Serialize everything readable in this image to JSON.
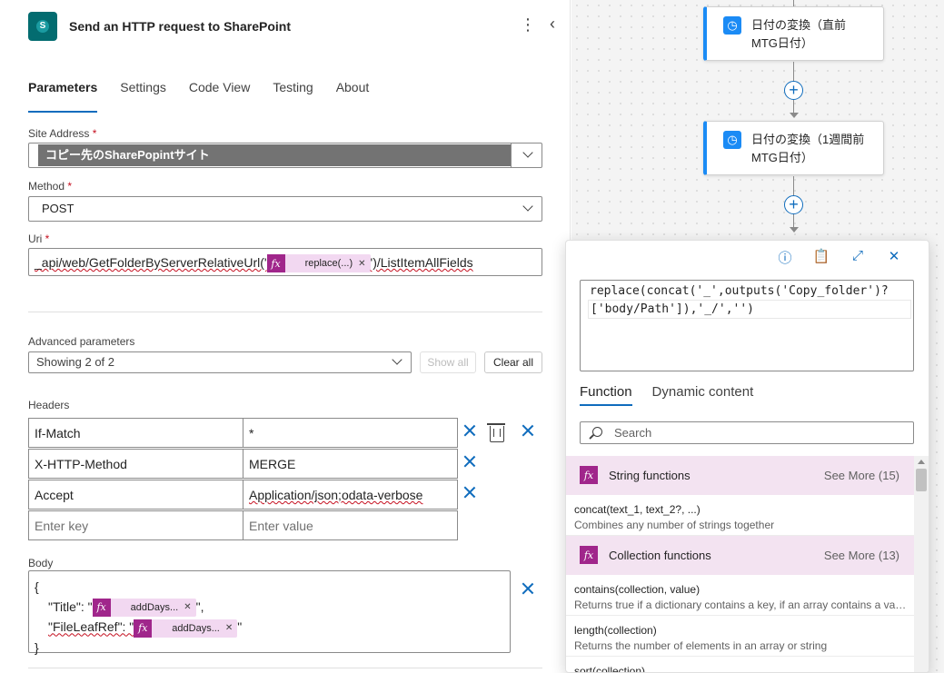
{
  "header": {
    "title": "Send an HTTP request to SharePoint",
    "icon": "sharepoint-icon"
  },
  "tabs": [
    "Parameters",
    "Settings",
    "Code View",
    "Testing",
    "About"
  ],
  "active_tab": "Parameters",
  "site_address": {
    "label": "Site Address",
    "value": "コピー先のSharePopintサイト"
  },
  "method": {
    "label": "Method",
    "value": "POST"
  },
  "uri": {
    "label": "Uri",
    "prefix": "_api/web/GetFolderByServerRelativeUrl('",
    "token": "replace(...)",
    "suffix": "')/ListItemAllFields"
  },
  "advanced": {
    "label": "Advanced parameters",
    "value": "Showing 2 of 2",
    "show_all": "Show all",
    "clear_all": "Clear all"
  },
  "headers": {
    "label": "Headers",
    "rows": [
      {
        "key": "If-Match",
        "value": "*"
      },
      {
        "key": "X-HTTP-Method",
        "value": "MERGE"
      },
      {
        "key": "Accept",
        "value": "Application/json;odata-verbose"
      }
    ],
    "key_placeholder": "Enter key",
    "value_placeholder": "Enter value"
  },
  "body": {
    "label": "Body",
    "open": "{",
    "title_key": "\"Title\": \"",
    "title_token": "addDays...",
    "title_end": "\",",
    "leaf_key": "\"FileLeafRef\": \"",
    "leaf_token": "addDays...",
    "leaf_end": "\"",
    "close": "}"
  },
  "flow": {
    "nodes": [
      {
        "line1": "日付の変換（直前",
        "line2": "MTG日付）"
      },
      {
        "line1": "日付の変換（1週間前",
        "line2": "MTG日付）"
      }
    ]
  },
  "flyout": {
    "expression_line1": "replace(concat('_',outputs('Copy_folder')?",
    "expression_line2": "['body/Path']),'_/','')",
    "tabs": [
      "Function",
      "Dynamic content"
    ],
    "search_placeholder": "Search",
    "categories": [
      {
        "title": "String functions",
        "more": "See More (15)",
        "functions": [
          {
            "name": "concat(text_1, text_2?, ...)",
            "desc": "Combines any number of strings together"
          }
        ]
      },
      {
        "title": "Collection functions",
        "more": "See More (13)",
        "functions": [
          {
            "name": "contains(collection, value)",
            "desc": "Returns true if a dictionary contains a key, if an array contains a value, or if a string contains a substring"
          },
          {
            "name": "length(collection)",
            "desc": "Returns the number of elements in an array or string"
          },
          {
            "name": "sort(collection)",
            "desc": ""
          }
        ]
      }
    ]
  },
  "colors": {
    "accent": "#0f6cbd",
    "token_bg": "#f2d8f1",
    "fx": "#a0268b",
    "node_accent": "#1b8bf5"
  }
}
